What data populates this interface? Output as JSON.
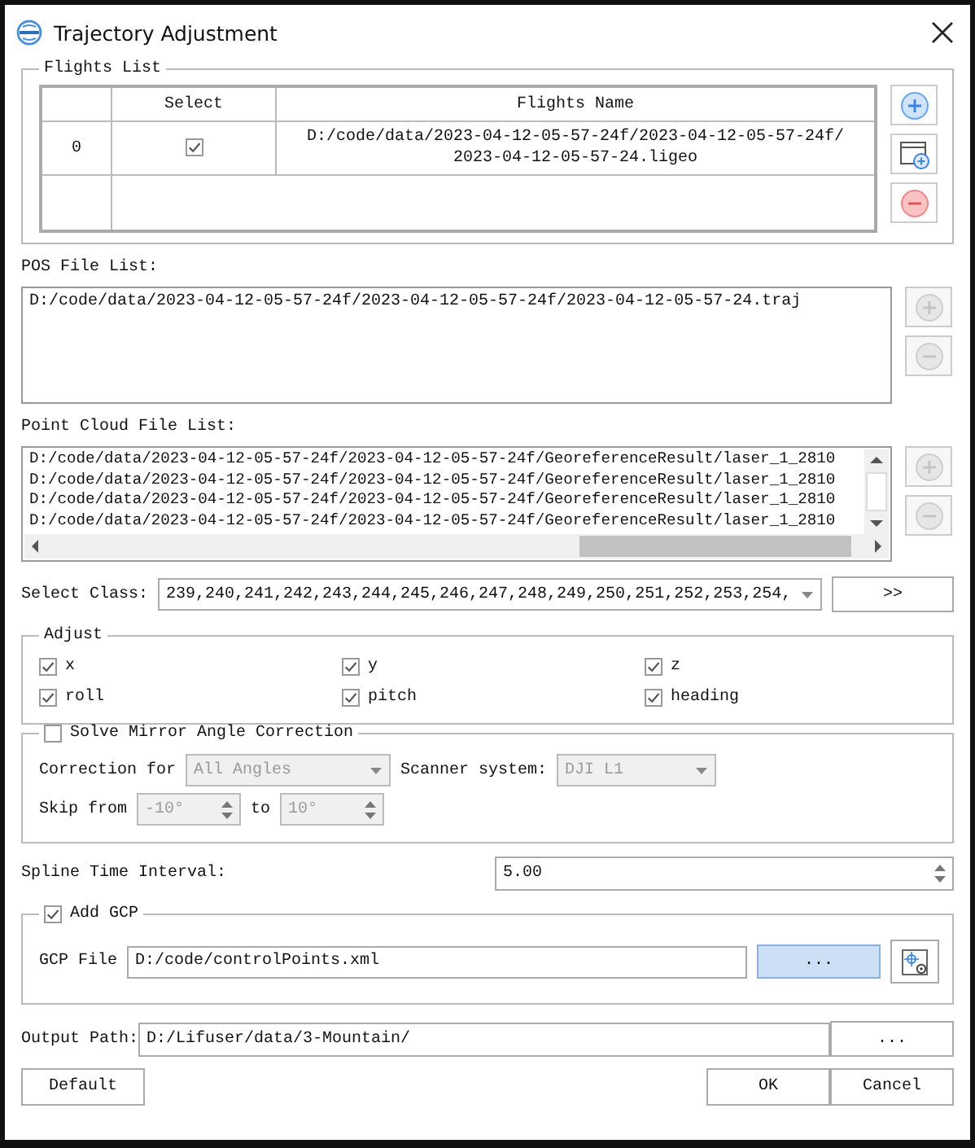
{
  "window": {
    "title": "Trajectory Adjustment"
  },
  "flights_list": {
    "title": "Flights List",
    "columns": [
      "Select",
      "Flights Name"
    ],
    "rows": [
      {
        "index": "0",
        "checked": true,
        "name_lines": [
          "D:/code/data/2023-04-12-05-57-24f/2023-04-12-05-57-24f/",
          "2023-04-12-05-57-24.ligeo"
        ]
      }
    ],
    "buttons": [
      {
        "kind": "add",
        "disabled": false
      },
      {
        "kind": "add-file",
        "disabled": false
      },
      {
        "kind": "remove",
        "disabled": false
      }
    ]
  },
  "pos_file_list": {
    "label": "POS File List:",
    "items": [
      "D:/code/data/2023-04-12-05-57-24f/2023-04-12-05-57-24f/2023-04-12-05-57-24.traj"
    ],
    "buttons": [
      {
        "kind": "add",
        "disabled": true
      },
      {
        "kind": "remove",
        "disabled": true
      }
    ]
  },
  "point_cloud_file_list": {
    "label": "Point Cloud File List:",
    "items": [
      "D:/code/data/2023-04-12-05-57-24f/2023-04-12-05-57-24f/GeoreferenceResult/laser_1_2810",
      "D:/code/data/2023-04-12-05-57-24f/2023-04-12-05-57-24f/GeoreferenceResult/laser_1_2810",
      "D:/code/data/2023-04-12-05-57-24f/2023-04-12-05-57-24f/GeoreferenceResult/laser_1_2810",
      "D:/code/data/2023-04-12-05-57-24f/2023-04-12-05-57-24f/GeoreferenceResult/laser_1_2810"
    ],
    "buttons": [
      {
        "kind": "add",
        "disabled": true
      },
      {
        "kind": "remove",
        "disabled": true
      }
    ]
  },
  "select_class": {
    "label": "Select Class:",
    "value": "239,240,241,242,243,244,245,246,247,248,249,250,251,252,253,254,",
    "button": ">>"
  },
  "adjust": {
    "title": "Adjust",
    "options": [
      {
        "label": "x",
        "checked": true
      },
      {
        "label": "y",
        "checked": true
      },
      {
        "label": "z",
        "checked": true
      },
      {
        "label": "roll",
        "checked": true
      },
      {
        "label": "pitch",
        "checked": true
      },
      {
        "label": "heading",
        "checked": true
      }
    ]
  },
  "mirror_correction": {
    "title": "Solve Mirror Angle Correction",
    "checked": false,
    "correction_for": {
      "label": "Correction for",
      "value": "All Angles",
      "disabled": true
    },
    "scanner_system": {
      "label": "Scanner system:",
      "value": "DJI L1",
      "disabled": true
    },
    "skip_from": {
      "label": "Skip from",
      "value": "-10°",
      "disabled": true
    },
    "skip_to": {
      "label": "to",
      "value": "10°",
      "disabled": true
    }
  },
  "spline_time_interval": {
    "label": "Spline Time Interval:",
    "value": "5.00"
  },
  "add_gcp": {
    "title": "Add GCP",
    "checked": true,
    "file_label": "GCP File",
    "file_value": "D:/code/controlPoints.xml",
    "browse_button": "...",
    "browse_highlighted": true
  },
  "output_path": {
    "label": "Output Path:",
    "value": "D:/Lifuser/data/3-Mountain/",
    "browse_button": "..."
  },
  "buttons": {
    "default": "Default",
    "ok": "OK",
    "cancel": "Cancel"
  }
}
